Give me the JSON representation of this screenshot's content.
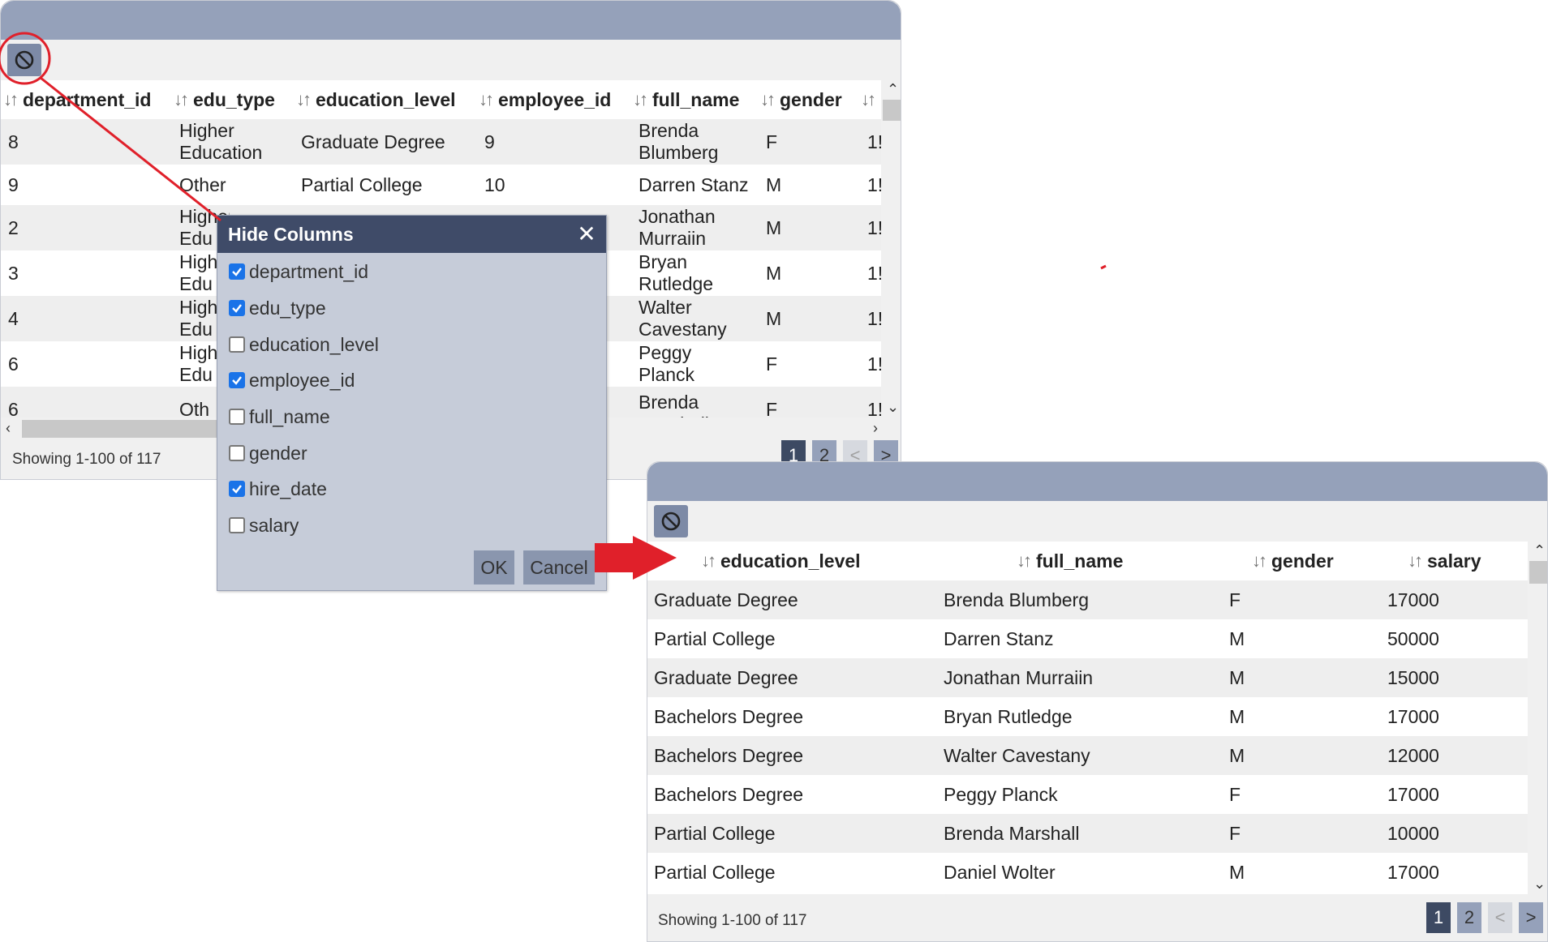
{
  "colors": {
    "titlebar": "#95a1ba",
    "dialog_header": "#3f4b68",
    "checkbox_checked": "#1a73e8",
    "annotation_red": "#e0202a",
    "pager_active": "#3d4a63"
  },
  "icons": {
    "hide_columns": "prohibit-icon",
    "sort": "sort-arrows-icon",
    "close": "close-icon"
  },
  "grid1": {
    "columns": [
      "department_id",
      "edu_type",
      "education_level",
      "employee_id",
      "full_name",
      "gender"
    ],
    "rows": [
      {
        "department_id": "8",
        "edu_type": "Higher Education",
        "education_level": "Graduate Degree",
        "employee_id": "9",
        "full_name": "Brenda Blumberg",
        "gender": "F",
        "hire_date": "1!"
      },
      {
        "department_id": "9",
        "edu_type": "Other",
        "education_level": "Partial College",
        "employee_id": "10",
        "full_name": "Darren Stanz",
        "gender": "M",
        "hire_date": "1!"
      },
      {
        "department_id": "2",
        "edu_type": "Higher Edu",
        "education_level": "",
        "employee_id": "",
        "full_name": "Jonathan Murraiin",
        "gender": "M",
        "hire_date": "1!"
      },
      {
        "department_id": "3",
        "edu_type": "High Edu",
        "education_level": "",
        "employee_id": "",
        "full_name": "Bryan Rutledge",
        "gender": "M",
        "hire_date": "1!"
      },
      {
        "department_id": "4",
        "edu_type": "High Edu",
        "education_level": "",
        "employee_id": "",
        "full_name": "Walter Cavestany",
        "gender": "M",
        "hire_date": "1!"
      },
      {
        "department_id": "6",
        "edu_type": "High Edu",
        "education_level": "",
        "employee_id": "",
        "full_name": "Peggy Planck",
        "gender": "F",
        "hire_date": "1!"
      },
      {
        "department_id": "6",
        "edu_type": "Oth",
        "education_level": "",
        "employee_id": "",
        "full_name": "Brenda Marshall",
        "gender": "F",
        "hire_date": "1!"
      }
    ],
    "status": "Showing 1-100 of 117",
    "pages": [
      "1",
      "2",
      "<",
      ">"
    ]
  },
  "dialog": {
    "title": "Hide Columns",
    "close": "✕",
    "options": [
      {
        "label": "department_id",
        "checked": true
      },
      {
        "label": "edu_type",
        "checked": true
      },
      {
        "label": "education_level",
        "checked": false
      },
      {
        "label": "employee_id",
        "checked": true
      },
      {
        "label": "full_name",
        "checked": false
      },
      {
        "label": "gender",
        "checked": false
      },
      {
        "label": "hire_date",
        "checked": true
      },
      {
        "label": "salary",
        "checked": false
      }
    ],
    "ok": "OK",
    "cancel": "Cancel"
  },
  "grid2": {
    "columns": [
      "education_level",
      "full_name",
      "gender",
      "salary"
    ],
    "rows": [
      {
        "education_level": "Graduate Degree",
        "full_name": "Brenda Blumberg",
        "gender": "F",
        "salary": "17000"
      },
      {
        "education_level": "Partial College",
        "full_name": "Darren Stanz",
        "gender": "M",
        "salary": "50000"
      },
      {
        "education_level": "Graduate Degree",
        "full_name": "Jonathan Murraiin",
        "gender": "M",
        "salary": "15000"
      },
      {
        "education_level": "Bachelors Degree",
        "full_name": "Bryan Rutledge",
        "gender": "M",
        "salary": "17000"
      },
      {
        "education_level": "Bachelors Degree",
        "full_name": "Walter Cavestany",
        "gender": "M",
        "salary": "12000"
      },
      {
        "education_level": "Bachelors Degree",
        "full_name": "Peggy Planck",
        "gender": "F",
        "salary": "17000"
      },
      {
        "education_level": "Partial College",
        "full_name": "Brenda Marshall",
        "gender": "F",
        "salary": "10000"
      },
      {
        "education_level": "Partial College",
        "full_name": "Daniel Wolter",
        "gender": "M",
        "salary": "17000"
      }
    ],
    "status": "Showing 1-100 of 117",
    "pages": [
      "1",
      "2",
      "<",
      ">"
    ]
  }
}
